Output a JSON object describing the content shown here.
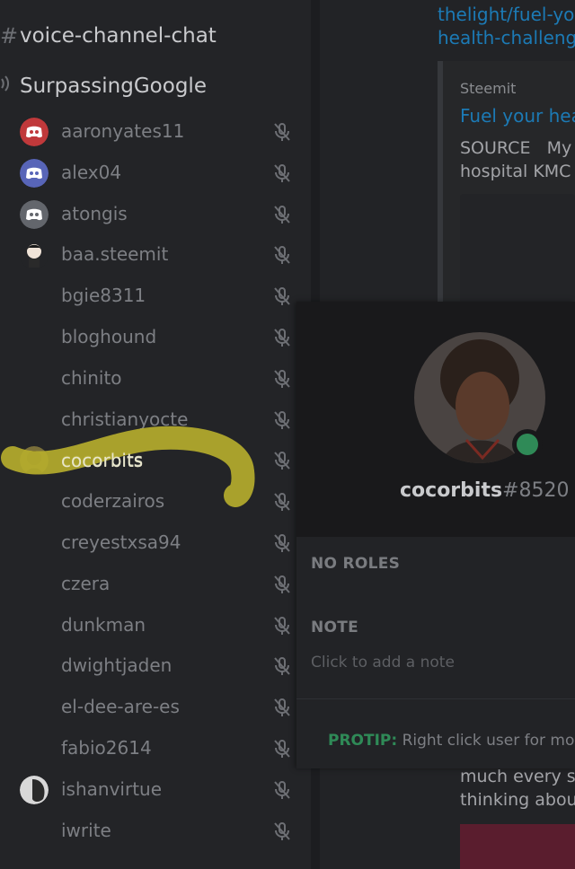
{
  "channels": {
    "text_channel": {
      "glyph": "#",
      "name": "voice-channel-chat"
    },
    "voice_channel": {
      "icon": "speaker-icon",
      "name": "SurpassingGoogle"
    }
  },
  "users": [
    {
      "name": "aaronyates11",
      "avatar": "discord-red"
    },
    {
      "name": "alex04",
      "avatar": "discord-blue"
    },
    {
      "name": "atongis",
      "avatar": "discord-grey"
    },
    {
      "name": "baa.steemit",
      "avatar": "cartoon"
    },
    {
      "name": "bgie8311",
      "avatar": "none"
    },
    {
      "name": "bloghound",
      "avatar": "none"
    },
    {
      "name": "chinito",
      "avatar": "none"
    },
    {
      "name": "christianyocte",
      "avatar": "none"
    },
    {
      "name": "cocorbits",
      "avatar": "photo"
    },
    {
      "name": "coderzairos",
      "avatar": "none"
    },
    {
      "name": "creyestxsa94",
      "avatar": "none"
    },
    {
      "name": "czera",
      "avatar": "none"
    },
    {
      "name": "dunkman",
      "avatar": "none"
    },
    {
      "name": "dwightjaden",
      "avatar": "none"
    },
    {
      "name": "el-dee-are-es",
      "avatar": "none"
    },
    {
      "name": "fabio2614",
      "avatar": "none"
    },
    {
      "name": "ishanvirtue",
      "avatar": "photo-grey"
    },
    {
      "name": "iwrite",
      "avatar": "none"
    }
  ],
  "chat": {
    "link_line1": "thelight/fuel-yo",
    "link_line2": "health-challeng",
    "embed_provider": "Steemit",
    "embed_title": "Fuel your hea",
    "embed_desc_line1": "SOURCE   My",
    "embed_desc_line2": "hospital KMC",
    "text_line1": "much every si",
    "text_line2": "thinking abou"
  },
  "popout": {
    "username": "cocorbits",
    "discriminator": "#8520",
    "roles_label": "NO ROLES",
    "note_label": "NOTE",
    "note_placeholder": "Click to add a note",
    "protip_label": "PROTIP:",
    "protip_text": " Right click user for more",
    "status_color": "#2f8a57"
  },
  "colors": {
    "link": "#1c7ab5",
    "highlight": "#b5ad2c"
  }
}
